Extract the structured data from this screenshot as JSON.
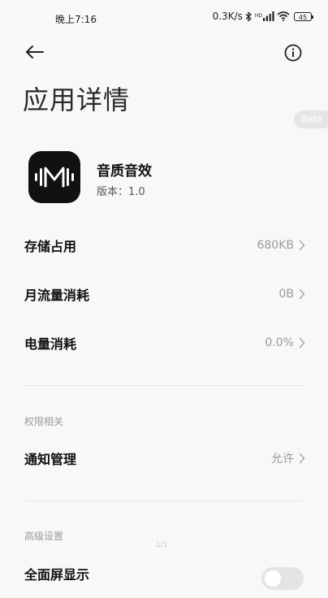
{
  "status_bar": {
    "time": "晚上7:16",
    "network_speed": "0.3K/s",
    "hd_label": "HD",
    "battery": "45"
  },
  "page": {
    "title": "应用详情",
    "beta_label": "Beta"
  },
  "app": {
    "name": "音质音效",
    "version": "版本：1.0",
    "icon": "soundwave-m-logo"
  },
  "usage": {
    "storage": {
      "label": "存储占用",
      "value": "680KB"
    },
    "data": {
      "label": "月流量消耗",
      "value": "0B"
    },
    "battery": {
      "label": "电量消耗",
      "value": "0.0%"
    }
  },
  "permissions": {
    "header": "权限相关",
    "notification": {
      "label": "通知管理",
      "value": "允许"
    }
  },
  "advanced": {
    "header": "高级设置",
    "fullscreen": {
      "label": "全面屏显示"
    }
  },
  "page_indicator": "1/1",
  "colors": {
    "background": "#f8f8f8",
    "text_primary": "#111111",
    "text_secondary": "#9a9a9a",
    "divider": "#e6e6e6",
    "app_icon_bg": "#111111"
  }
}
